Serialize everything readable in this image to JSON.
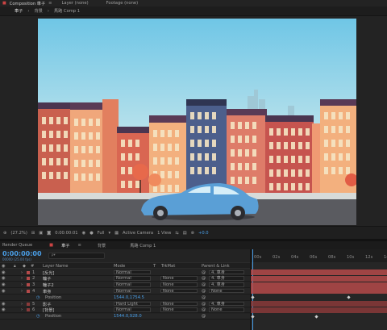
{
  "top_tabs": {
    "composition": "Composition 車子",
    "layer": "Layer (none)",
    "footage": "Footage (none)"
  },
  "comp_tabs": [
    "車子",
    "背景",
    "馬路 Comp 1"
  ],
  "viewer_controls": {
    "zoom": "(27.2%)",
    "timecode": "0:00:00:01",
    "resolution": "Full",
    "camera": "Active Camera",
    "view": "1 View",
    "offset": "+0.0"
  },
  "timeline_tabs": {
    "render_queue": "Render Queue",
    "tabs": [
      "車子",
      "背景",
      "馬路 Comp 1"
    ]
  },
  "timeline": {
    "timecode": "0:00:00:00",
    "frame_info": "00000 (25.00 fps)",
    "search_placeholder": "ρ▾",
    "columns": {
      "layer_name": "Layer Name",
      "mode": "Mode",
      "t": "T",
      "trkmat": "TrkMat",
      "parent": "Parent & Link"
    },
    "ruler": [
      "00s",
      "02s",
      "04s",
      "06s",
      "08s",
      "10s",
      "12s",
      "14s"
    ],
    "layers": [
      {
        "num": "1",
        "name": "[反光]",
        "mode": "Normal",
        "trkmat": "",
        "parent": "4. 車身",
        "color": "#b54a4a"
      },
      {
        "num": "2",
        "name": "輪子",
        "mode": "Normal",
        "trkmat": "None",
        "parent": "4. 車身",
        "color": "#b54a4a"
      },
      {
        "num": "3",
        "name": "輪子2",
        "mode": "Normal",
        "trkmat": "None",
        "parent": "4. 車身",
        "color": "#b54a4a"
      },
      {
        "num": "4",
        "name": "車身",
        "mode": "Normal",
        "trkmat": "None",
        "parent": "None",
        "color": "#b54a4a"
      },
      {
        "num": "",
        "name": "Position",
        "prop_value": "1544.0,1754.5",
        "is_prop": true
      },
      {
        "num": "5",
        "name": "影子",
        "mode": "Hard Light",
        "trkmat": "None",
        "parent": "4. 車身",
        "color": "#8a3a3a"
      },
      {
        "num": "6",
        "name": "[背景]",
        "mode": "Normal",
        "trkmat": "None",
        "parent": "None",
        "color": "#8a3a3a"
      },
      {
        "num": "",
        "name": "Position",
        "prop_value": "1544.0,928.0",
        "is_prop": true
      }
    ]
  }
}
